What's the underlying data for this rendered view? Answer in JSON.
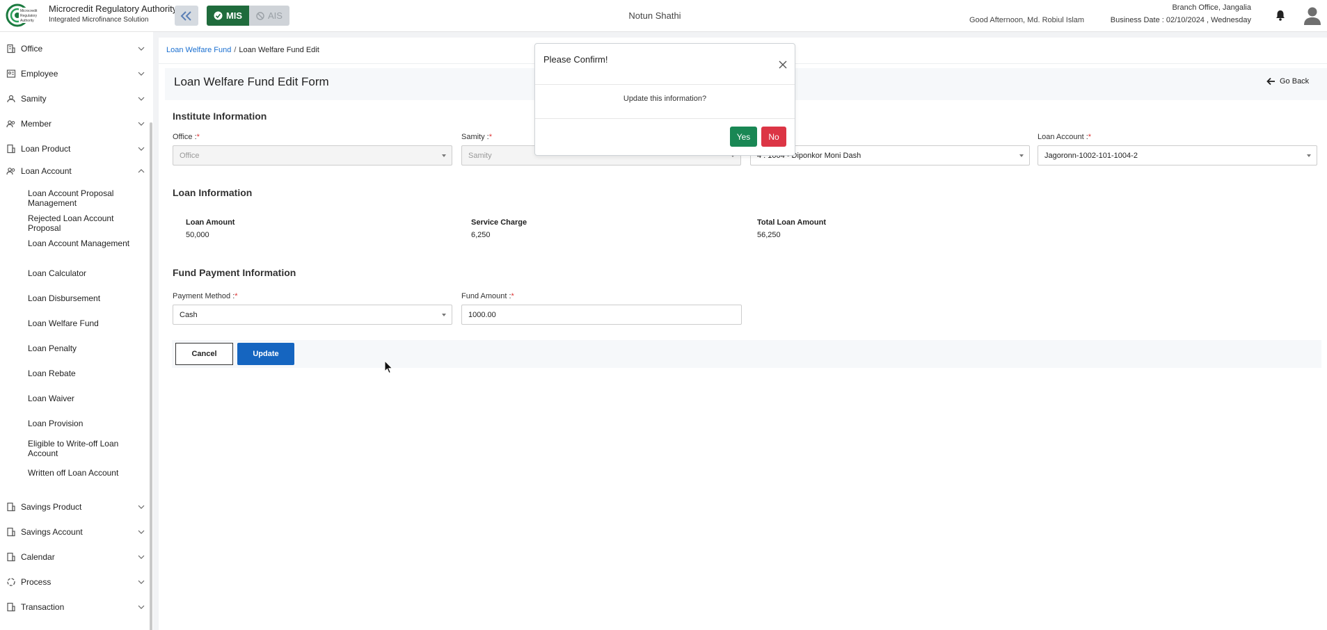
{
  "header": {
    "brand_title": "Microcredit Regulatory Authority",
    "brand_sub": "Integrated Microfinance Solution",
    "logo_text": "Microcredit Regulatory Authority",
    "mis_label": "MIS",
    "ais_label": "AIS",
    "org_name": "Notun Shathi",
    "greeting": "Good Afternoon, Md. Robiul Islam",
    "branch": "Branch Office, Jangalia",
    "business_date": "Business Date : 02/10/2024 , Wednesday",
    "colors": {
      "mis_active": "#1f6b3c",
      "ais_inactive": "#cfd3d8"
    }
  },
  "sidebar": {
    "items": [
      {
        "label": "Office",
        "icon": "building-icon"
      },
      {
        "label": "Employee",
        "icon": "id-card-icon"
      },
      {
        "label": "Samity",
        "icon": "group-icon"
      },
      {
        "label": "Member",
        "icon": "users-icon"
      },
      {
        "label": "Loan Product",
        "icon": "building-icon"
      },
      {
        "label": "Loan Account",
        "icon": "users-icon",
        "expanded": true
      }
    ],
    "sub_items": [
      "Loan Account Proposal Management",
      "Rejected Loan Account Proposal",
      "Loan Account Management",
      "Loan Calculator",
      "Loan Disbursement",
      "Loan Welfare Fund",
      "Loan Penalty",
      "Loan Rebate",
      "Loan Waiver",
      "Loan Provision",
      "Eligible to Write-off Loan Account",
      "Written off Loan Account"
    ],
    "items_after": [
      {
        "label": "Savings Product",
        "icon": "building-icon"
      },
      {
        "label": "Savings Account",
        "icon": "building-icon"
      },
      {
        "label": "Calendar",
        "icon": "building-icon"
      },
      {
        "label": "Process",
        "icon": "process-icon"
      },
      {
        "label": "Transaction",
        "icon": "building-icon"
      }
    ]
  },
  "breadcrumb": {
    "parent": "Loan Welfare Fund",
    "separator": "/",
    "current": "Loan Welfare Fund Edit"
  },
  "form": {
    "title": "Loan Welfare Fund Edit Form",
    "go_back": "Go Back",
    "institute": {
      "title": "Institute Information",
      "office": {
        "label": "Office :",
        "placeholder": "Office"
      },
      "samity": {
        "label": "Samity :",
        "placeholder": "Samity"
      },
      "member": {
        "value": "4 : 1004 - Diponkor Moni Dash"
      },
      "loan_account": {
        "label": "Loan Account :",
        "value": "Jagoronn-1002-101-1004-2"
      }
    },
    "loan": {
      "title": "Loan Information",
      "fields": [
        {
          "label": "Loan Amount",
          "value": "50,000"
        },
        {
          "label": "Service Charge",
          "value": "6,250"
        },
        {
          "label": "Total Loan Amount",
          "value": "56,250"
        }
      ]
    },
    "fund": {
      "title": "Fund Payment Information",
      "payment_method": {
        "label": "Payment Method :",
        "value": "Cash"
      },
      "fund_amount": {
        "label": "Fund Amount :",
        "value": "1000.00"
      }
    },
    "required_mark": "*",
    "cancel_label": "Cancel",
    "update_label": "Update"
  },
  "modal": {
    "title": "Please Confirm!",
    "message": "Update this information?",
    "yes_label": "Yes",
    "no_label": "No",
    "colors": {
      "yes": "#198754",
      "no": "#dc3545"
    }
  }
}
